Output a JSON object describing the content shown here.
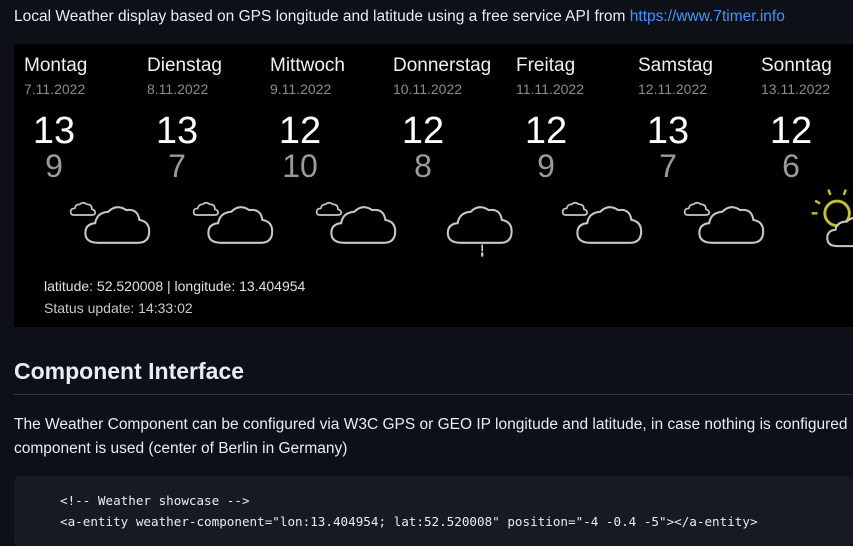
{
  "intro": {
    "text": "Local Weather display based on GPS longitude and latitude using a free service API from ",
    "link": "https://www.7timer.info"
  },
  "weather": {
    "days": [
      {
        "name": "Montag",
        "date": "7.11.2022",
        "high": "13",
        "low": "9",
        "icon": "cloud-icon"
      },
      {
        "name": "Dienstag",
        "date": "8.11.2022",
        "high": "13",
        "low": "7",
        "icon": "cloud-icon"
      },
      {
        "name": "Mittwoch",
        "date": "9.11.2022",
        "high": "12",
        "low": "10",
        "icon": "cloud-icon"
      },
      {
        "name": "Donnerstag",
        "date": "10.11.2022",
        "high": "12",
        "low": "8",
        "icon": "rain-cloud-icon"
      },
      {
        "name": "Freitag",
        "date": "11.11.2022",
        "high": "12",
        "low": "9",
        "icon": "cloud-icon"
      },
      {
        "name": "Samstag",
        "date": "12.11.2022",
        "high": "13",
        "low": "7",
        "icon": "cloud-icon"
      },
      {
        "name": "Sonntag",
        "date": "13.11.2022",
        "high": "12",
        "low": "6",
        "icon": "partly-sunny-icon"
      }
    ],
    "coords": "latitude: 52.520008 | longitude: 13.404954",
    "status": "Status update: 14:33:02",
    "colors": {
      "icon_stroke": "#c8c8c8",
      "sun": "#c8c21e"
    }
  },
  "section": {
    "title": "Component Interface",
    "para_line1": "The Weather Component can be configured via W3C GPS or GEO IP longitude and latitude, in case nothing is configured",
    "para_line2": "component is used (center of Berlin in Germany)"
  },
  "code": {
    "line1": "<!-- Weather showcase -->",
    "line2": "<a-entity weather-component=\"lon:13.404954; lat:52.520008\" position=\"-4 -0.4 -5\"></a-entity>"
  }
}
